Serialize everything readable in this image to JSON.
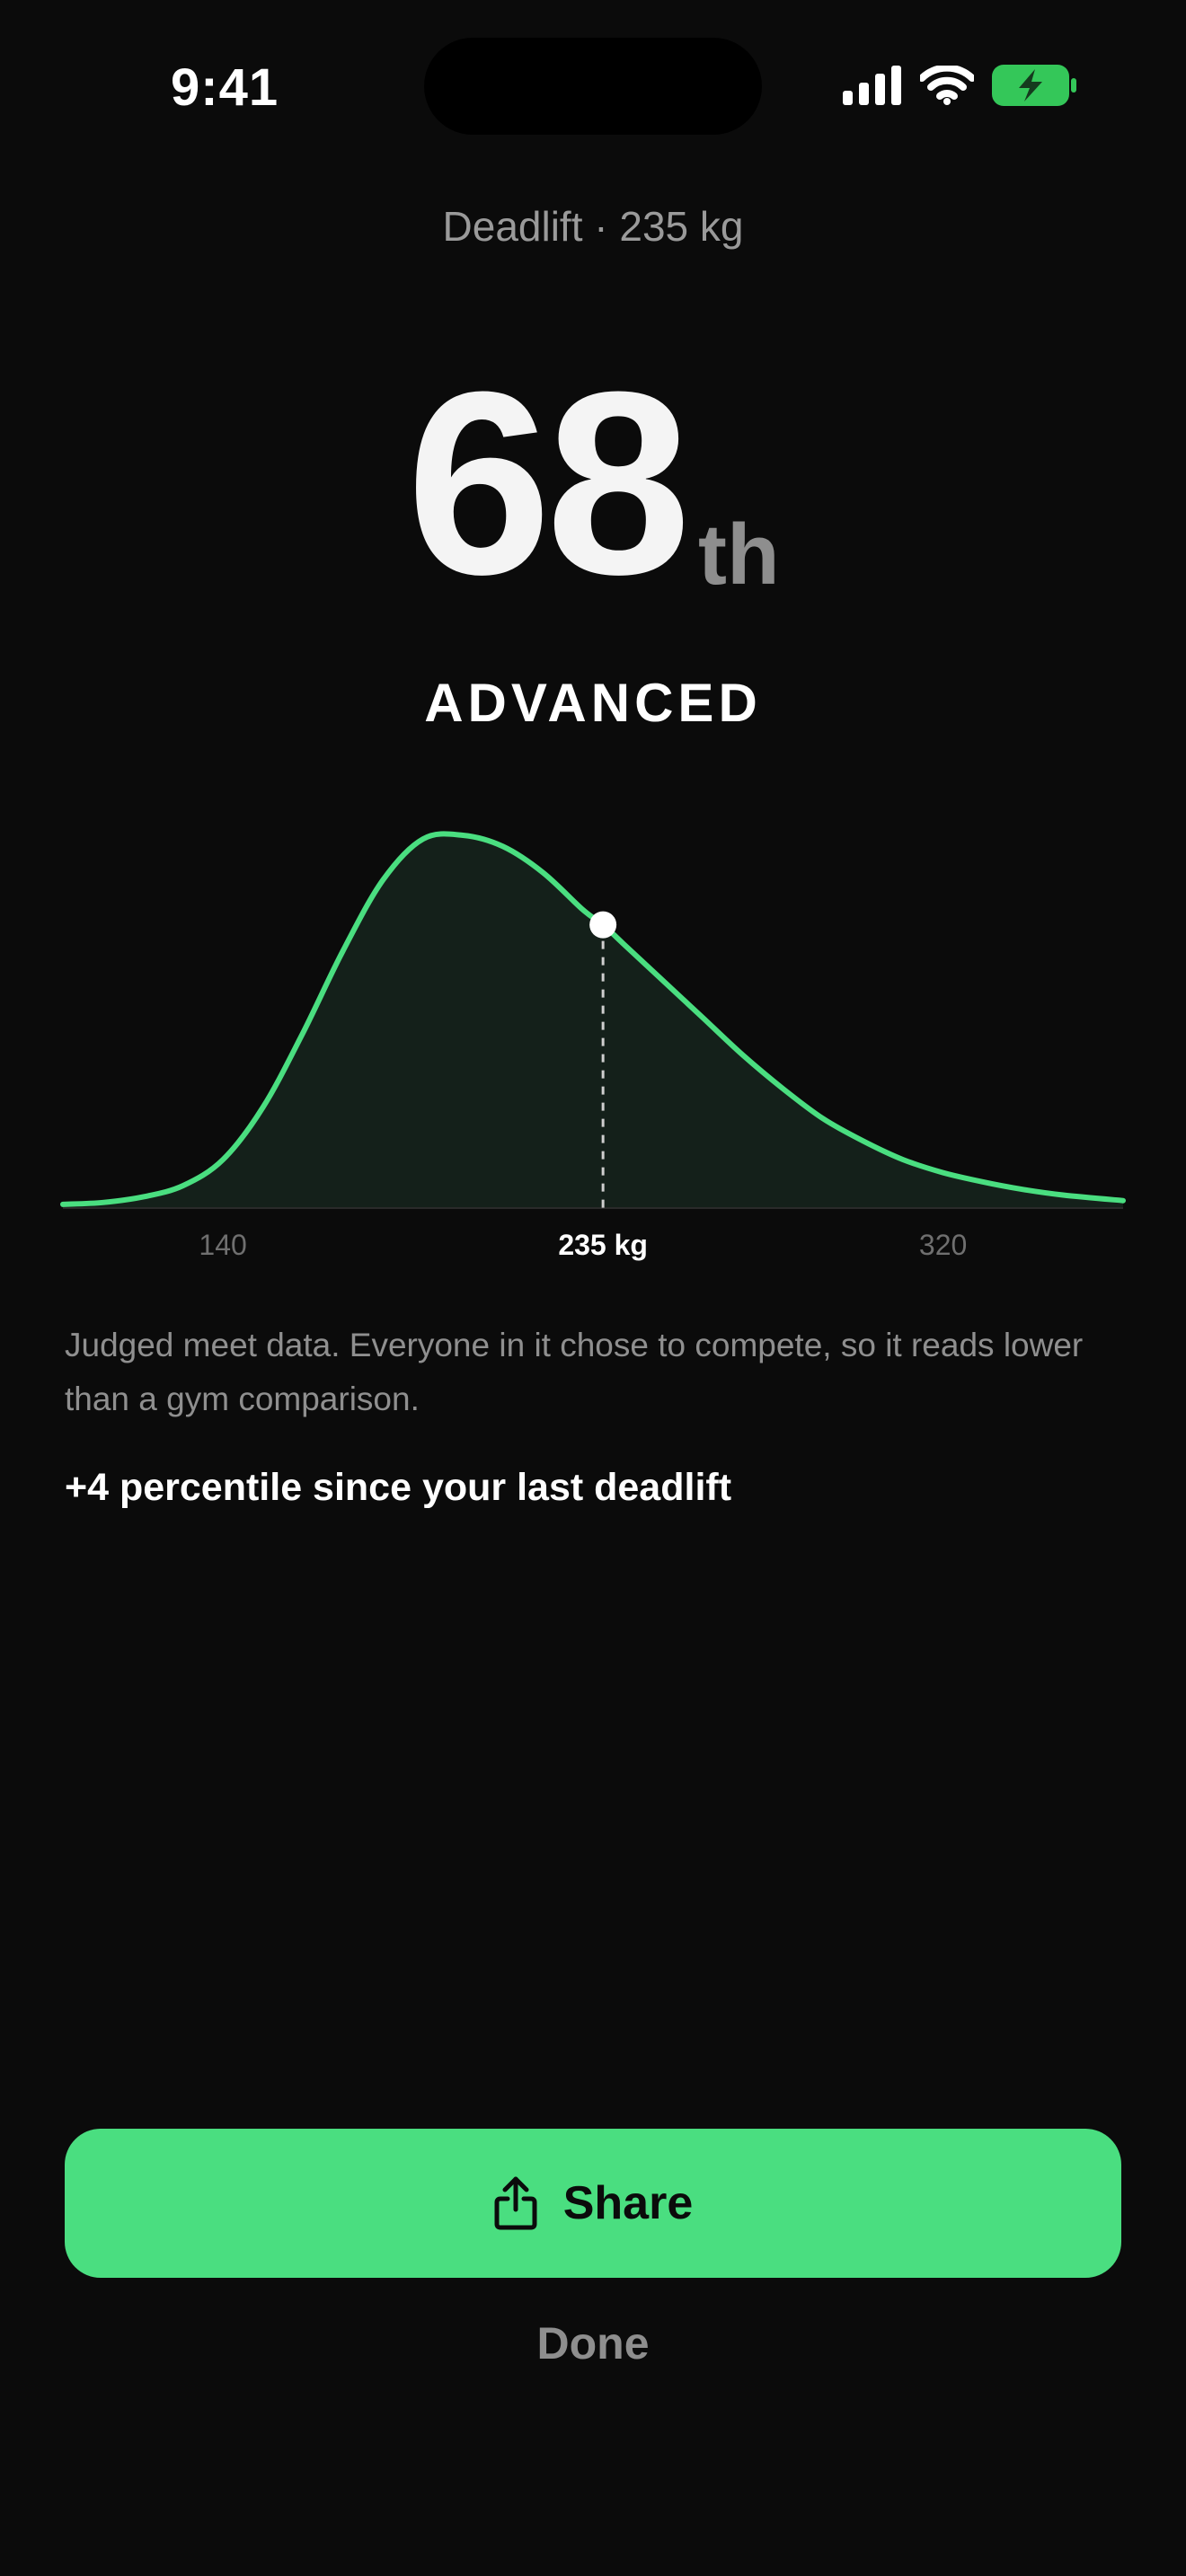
{
  "status_bar": {
    "time": "9:41",
    "icons": [
      "cellular-signal-icon",
      "wifi-icon",
      "battery-charging-icon"
    ],
    "battery_color": "#34c759"
  },
  "header": {
    "lift_label": "Deadlift · 235 kg"
  },
  "result": {
    "percentile": "68",
    "suffix": "th",
    "tier": "ADVANCED"
  },
  "chart_data": {
    "type": "area",
    "title": "",
    "xlabel": "",
    "ylabel": "",
    "x_ticks": [
      {
        "value": 140,
        "label": "140",
        "highlight": false
      },
      {
        "value": 235,
        "label": "235 kg",
        "highlight": true
      },
      {
        "value": 320,
        "label": "320",
        "highlight": false
      }
    ],
    "xlim": [
      100,
      365
    ],
    "x": [
      100,
      110,
      120,
      130,
      140,
      150,
      160,
      170,
      180,
      190,
      200,
      210,
      220,
      230,
      235,
      240,
      250,
      260,
      270,
      280,
      290,
      300,
      310,
      320,
      330,
      340,
      350,
      365
    ],
    "y": [
      0.01,
      0.015,
      0.03,
      0.06,
      0.13,
      0.27,
      0.47,
      0.69,
      0.88,
      0.99,
      1.0,
      0.97,
      0.9,
      0.8,
      0.76,
      0.71,
      0.61,
      0.51,
      0.41,
      0.32,
      0.24,
      0.18,
      0.13,
      0.095,
      0.07,
      0.05,
      0.035,
      0.02
    ],
    "marker": {
      "x": 235,
      "y": 0.76
    },
    "line_color": "#4ade80",
    "fill_color": "#14201a",
    "marker_color": "#ffffff"
  },
  "description": "Judged meet data. Everyone in it chose to compete, so it reads lower than a gym comparison.",
  "change_note": "+4 percentile since your last deadlift",
  "actions": {
    "share_label": "Share",
    "share_icon": "share-icon",
    "done_label": "Done",
    "accent": "#4ade80"
  }
}
